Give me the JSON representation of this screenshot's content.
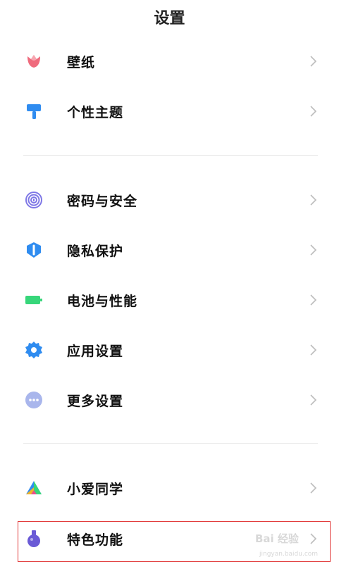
{
  "header": {
    "title": "设置"
  },
  "items": [
    {
      "label": "壁纸",
      "icon": "tulip-icon"
    },
    {
      "label": "个性主题",
      "icon": "paint-roller-icon"
    },
    {
      "label": "密码与安全",
      "icon": "fingerprint-icon"
    },
    {
      "label": "隐私保护",
      "icon": "privacy-shield-icon"
    },
    {
      "label": "电池与性能",
      "icon": "battery-icon"
    },
    {
      "label": "应用设置",
      "icon": "gear-icon"
    },
    {
      "label": "更多设置",
      "icon": "more-dots-icon"
    },
    {
      "label": "小爱同学",
      "icon": "xiaoai-icon"
    },
    {
      "label": "特色功能",
      "icon": "flask-icon"
    }
  ],
  "watermark": {
    "text": "Bai 经验",
    "subtext": "jingyan.baidu.com"
  },
  "colors": {
    "highlight_border": "#e23b3b",
    "chevron": "#bdbdbd",
    "divider": "#e9e9e9"
  }
}
